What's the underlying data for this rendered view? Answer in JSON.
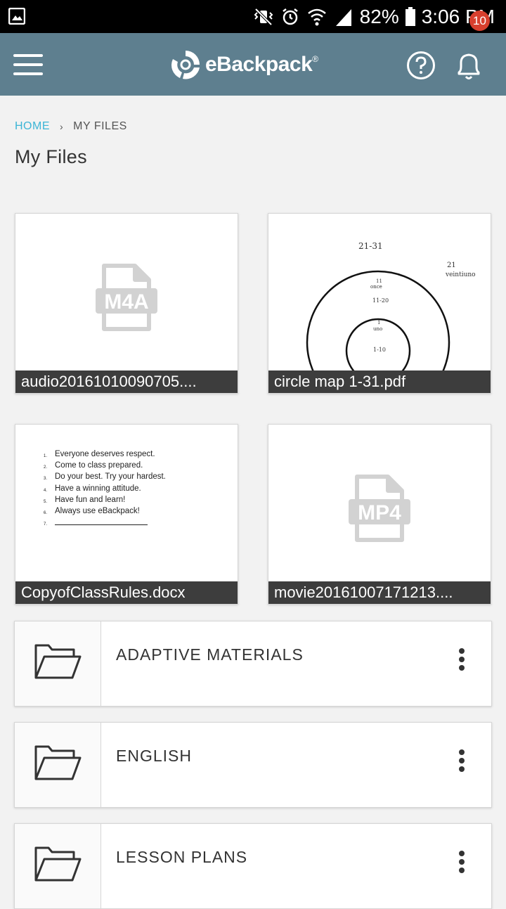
{
  "status_bar": {
    "battery": "82%",
    "time": "3:06 PM"
  },
  "app_bar": {
    "brand": "eBackpack",
    "registered": "®",
    "notification_count": "10"
  },
  "breadcrumb": {
    "home": "HOME",
    "separator": "›",
    "current": "MY FILES"
  },
  "page": {
    "title": "My Files"
  },
  "files": [
    {
      "name": "audio20161010090705....",
      "type_label": "M4A",
      "icon": "m4a-file-icon"
    },
    {
      "name": "circle map 1-31.pdf",
      "type_label": "",
      "icon": "pdf-preview"
    },
    {
      "name": "CopyofClassRules.docx",
      "type_label": "",
      "icon": "docx-preview"
    },
    {
      "name": "movie20161007171213....",
      "type_label": "MP4",
      "icon": "mp4-file-icon"
    }
  ],
  "pdf_preview": {
    "top_label": "21-31",
    "side_label_1": "21",
    "side_label_2": "veintiuno",
    "outer_label_1": "11",
    "outer_label_2": "once",
    "outer_range": "11-20",
    "inner_label_1": "1",
    "inner_label_2": "uno",
    "inner_range": "1-10"
  },
  "docx_preview": {
    "lines": [
      {
        "n": "1.",
        "text": "Everyone deserves respect."
      },
      {
        "n": "2.",
        "text": "Come to class prepared."
      },
      {
        "n": "3.",
        "text": "Do your best.  Try your hardest."
      },
      {
        "n": "4.",
        "text": "Have a winning attitude."
      },
      {
        "n": "5.",
        "text": "Have fun and learn!"
      },
      {
        "n": "6.",
        "text": "Always use eBackpack!"
      },
      {
        "n": "7.",
        "text": ""
      }
    ]
  },
  "folders": [
    {
      "label": "ADAPTIVE MATERIALS"
    },
    {
      "label": "ENGLISH"
    },
    {
      "label": "LESSON PLANS"
    }
  ],
  "colors": {
    "app_bar": "#5e7f8f",
    "accent": "#3cb5d6",
    "badge": "#d8402e",
    "caption_bg": "#3d3d3d"
  }
}
